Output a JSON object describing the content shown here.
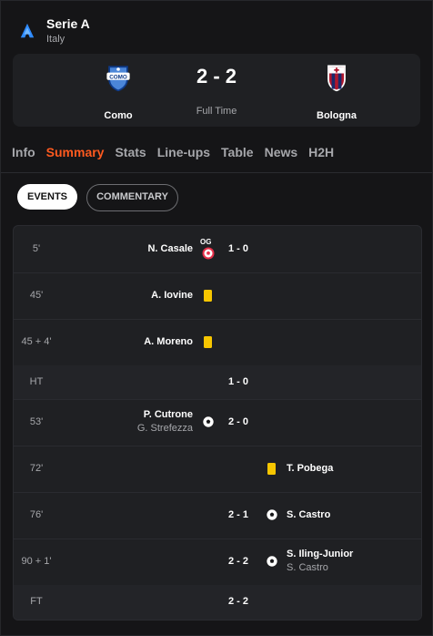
{
  "league": {
    "name": "Serie A",
    "country": "Italy"
  },
  "match": {
    "home": {
      "name": "Como"
    },
    "away": {
      "name": "Bologna"
    },
    "score": "2 - 2",
    "status": "Full Time"
  },
  "tabs": [
    {
      "label": "Info"
    },
    {
      "label": "Summary",
      "active": true
    },
    {
      "label": "Stats"
    },
    {
      "label": "Line-ups"
    },
    {
      "label": "Table"
    },
    {
      "label": "News"
    },
    {
      "label": "H2H"
    }
  ],
  "subtabs": {
    "events": "EVENTS",
    "commentary": "COMMENTARY"
  },
  "events": [
    {
      "minute": "5'",
      "home_player": "N. Casale",
      "icon": "own-goal-icon",
      "og": "OG",
      "score": "1 - 0"
    },
    {
      "minute": "45'",
      "home_player": "A. Iovine",
      "icon": "yellow-card-icon"
    },
    {
      "minute": "45 + 4'",
      "home_player": "A. Moreno",
      "icon": "yellow-card-icon"
    },
    {
      "minute": "HT",
      "score": "1 - 0",
      "separator": true
    },
    {
      "minute": "53'",
      "home_player": "P. Cutrone",
      "home_sub": "G. Strefezza",
      "icon": "goal-icon",
      "score": "2 - 0"
    },
    {
      "minute": "72'",
      "away_player": "T. Pobega",
      "icon": "yellow-card-icon"
    },
    {
      "minute": "76'",
      "away_player": "S. Castro",
      "icon": "goal-icon",
      "score": "2 - 1"
    },
    {
      "minute": "90 + 1'",
      "away_player": "S. Iling-Junior",
      "away_sub": "S. Castro",
      "icon": "goal-icon",
      "score": "2 - 2"
    },
    {
      "minute": "FT",
      "score": "2 - 2",
      "separator": true
    }
  ],
  "colors": {
    "accent": "#ff5a1f",
    "background": "#151517",
    "card": "#1f2023",
    "yellow_card": "#f7c600",
    "own_goal": "#e8304a"
  }
}
